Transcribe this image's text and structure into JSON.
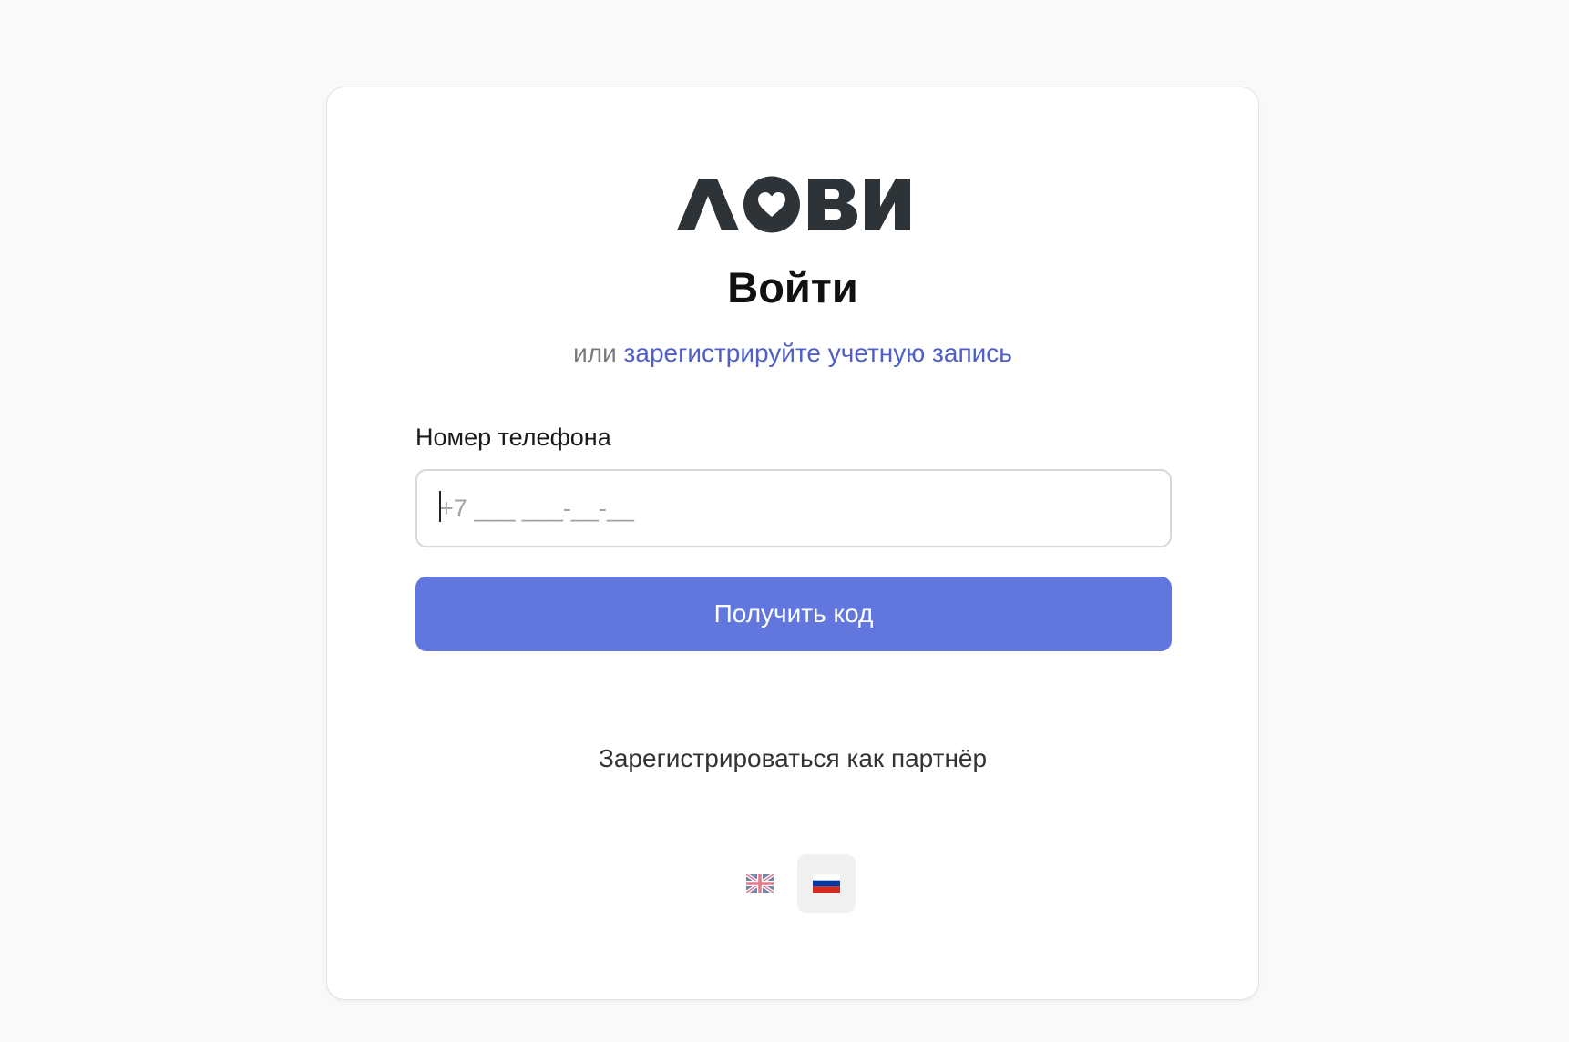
{
  "header": {
    "logo_text": "ЛОВИ",
    "title": "Войти",
    "subtitle_prefix": "или",
    "register_link": "зарегистрируйте учетную запись"
  },
  "form": {
    "phone_label": "Номер телефона",
    "phone_placeholder": "+7 ___ ___-__-__",
    "phone_value": "",
    "submit_label": "Получить код"
  },
  "footer": {
    "partner_link": "Зарегистрироваться как партнёр",
    "languages": [
      {
        "code": "en",
        "icon": "uk-flag-icon",
        "selected": false
      },
      {
        "code": "ru",
        "icon": "russia-flag-icon",
        "selected": true
      }
    ]
  },
  "colors": {
    "accent": "#6277dd",
    "link": "#4f5fc4",
    "logo": "#2d3336",
    "background": "#f9f9f9"
  }
}
